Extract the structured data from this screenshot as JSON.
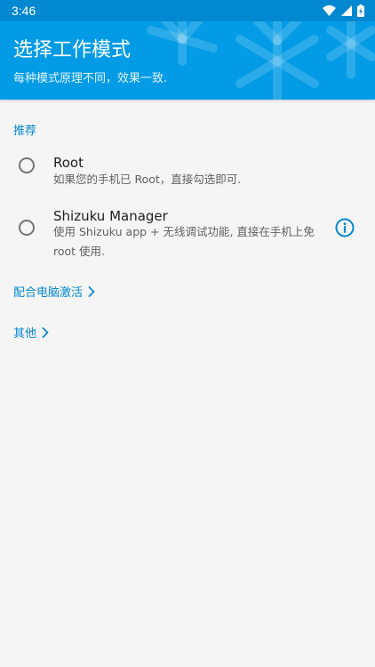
{
  "status_bar": {
    "time": "3:46",
    "icons": [
      "wifi-icon",
      "cell-signal-icon",
      "battery-icon"
    ]
  },
  "header": {
    "title": "选择工作模式",
    "subtitle": "每种模式原理不同，效果一致.",
    "background": "#039be5"
  },
  "section": {
    "label": "推荐"
  },
  "options": [
    {
      "title": "Root",
      "description": "如果您的手机已 Root，直接勾选即可.",
      "selected": false
    },
    {
      "title": "Shizuku Manager",
      "description": "使用 Shizuku app + 无线调试功能, 直接在手机上免 root 使用.",
      "selected": false,
      "icon": "info-icon"
    }
  ],
  "links": [
    {
      "label": "配合电脑激活",
      "icon": "chevron-right-icon"
    },
    {
      "label": "其他",
      "icon": "chevron-right-icon"
    }
  ],
  "colors": {
    "accent": "#0288d1",
    "status_bar": "#0288d1",
    "page_background": "#f5f5f5"
  }
}
